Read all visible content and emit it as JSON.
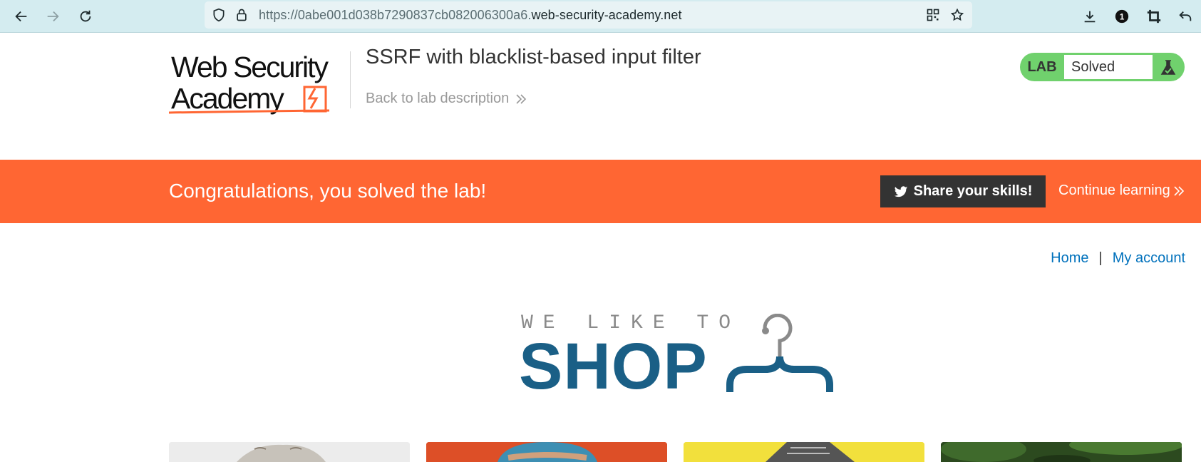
{
  "browser": {
    "url_prefix": "https://0abe001d038b7290837cb082006300a6.",
    "url_domain": "web-security-academy.net",
    "notification_count": "1"
  },
  "header": {
    "logo_line1": "Web Security",
    "logo_line2": "Academy",
    "lab_title": "SSRF with blacklist-based input filter",
    "back_link": "Back to lab description",
    "lab_status_label": "LAB",
    "lab_status_value": "Solved"
  },
  "banner": {
    "message": "Congratulations, you solved the lab!",
    "share_label": "Share your skills!",
    "continue_label": "Continue learning"
  },
  "nav": {
    "home": "Home",
    "separator": "|",
    "account": "My account"
  },
  "shop_logo": {
    "tagline": "WE LIKE TO",
    "word": "SHOP"
  },
  "colors": {
    "accent_orange": "#ff6633",
    "lab_green": "#70d16d",
    "shop_blue": "#1a5f86",
    "link_blue": "#0071bc"
  },
  "product_cards": [
    {
      "name": "card-1",
      "color": "#e9e9e9"
    },
    {
      "name": "card-2",
      "color": "#e2522a"
    },
    {
      "name": "card-3",
      "color": "#f1df3f"
    },
    {
      "name": "card-4",
      "color": "#2f4a21"
    }
  ]
}
